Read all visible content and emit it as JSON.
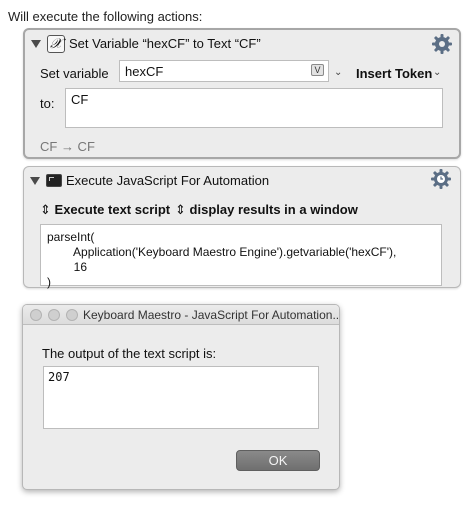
{
  "heading": "Will execute the following actions:",
  "action1": {
    "title": "Set Variable “hexCF” to Text “CF”",
    "set_variable_label": "Set variable",
    "variable_value": "hexCF",
    "var_badge": "V",
    "insert_token_label": "Insert Token",
    "to_label": "to:",
    "to_value": "CF",
    "preview": "CF → CF"
  },
  "action2": {
    "title": "Execute JavaScript For Automation",
    "execute_option": "Execute text script",
    "results_option": "display results in a window",
    "script": "parseInt(\n        Application('Keyboard Maestro Engine').getvariable('hexCF'),\n        16\n)"
  },
  "popup": {
    "title": "Keyboard Maestro - JavaScript For Automation...",
    "message": "The output of the text script is:",
    "output": "207",
    "ok_label": "OK"
  },
  "icons": {
    "collapse": "disclosure-triangle-down",
    "gear": "gear-icon",
    "variable": "x-variable-icon",
    "terminal": "terminal-icon"
  }
}
